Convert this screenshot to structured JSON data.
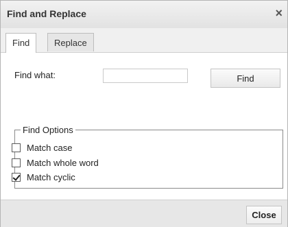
{
  "dialog": {
    "title": "Find and Replace",
    "close_icon": "close-icon",
    "close_glyph": "×"
  },
  "tabs": [
    {
      "label": "Find",
      "active": true
    },
    {
      "label": "Replace",
      "active": false
    }
  ],
  "find": {
    "label": "Find what:",
    "value": "",
    "placeholder": "",
    "button_label": "Find"
  },
  "options": {
    "legend": "Find Options",
    "items": [
      {
        "label": "Match case",
        "checked": false
      },
      {
        "label": "Match whole word",
        "checked": false
      },
      {
        "label": "Match cyclic",
        "checked": true
      }
    ]
  },
  "footer": {
    "close_label": "Close"
  }
}
